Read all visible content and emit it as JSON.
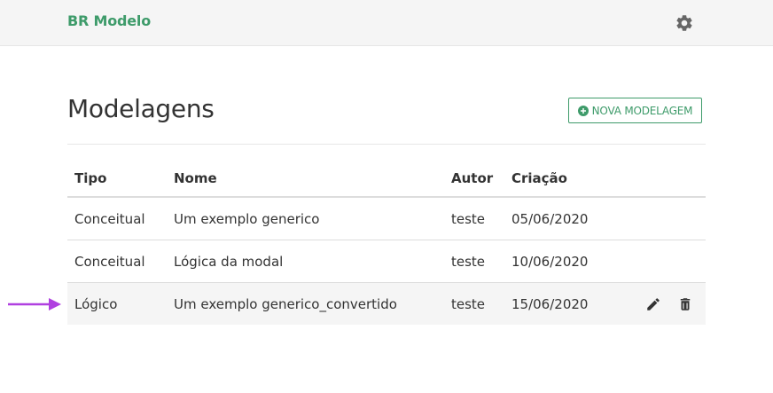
{
  "navbar": {
    "brand": "BR Modelo",
    "settings_icon": "gear-icon"
  },
  "page": {
    "title": "Modelagens",
    "new_button_label": "NOVA MODELAGEM",
    "new_button_icon": "plus-circle-icon"
  },
  "table": {
    "columns": [
      "Tipo",
      "Nome",
      "Autor",
      "Criação"
    ],
    "rows": [
      {
        "tipo": "Conceitual",
        "nome": "Um exemplo generico",
        "autor": "teste",
        "criacao": "05/06/2020"
      },
      {
        "tipo": "Conceitual",
        "nome": "Lógica da modal",
        "autor": "teste",
        "criacao": "10/06/2020"
      },
      {
        "tipo": "Lógico",
        "nome": "Um exemplo generico_convertido",
        "autor": "teste",
        "criacao": "15/06/2020"
      }
    ],
    "row_actions": [
      "pencil-icon",
      "trash-icon"
    ]
  },
  "annotation": {
    "icon": "arrow-right-icon",
    "color": "#b040e0"
  },
  "colors": {
    "brand": "#3e9b6a",
    "text": "#333333",
    "navbar_bg": "#f5f5f5",
    "selected_row_bg": "#f5f5f5"
  }
}
